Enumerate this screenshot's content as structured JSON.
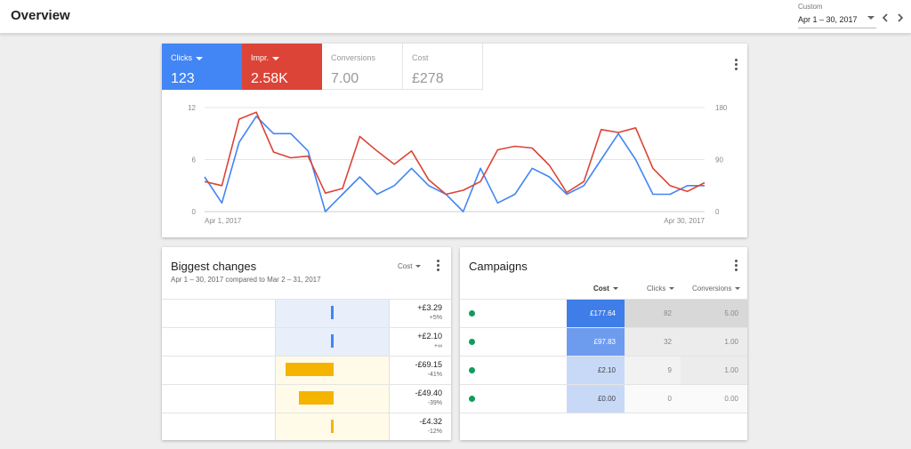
{
  "header": {
    "title": "Overview",
    "date_caption": "Custom",
    "date_range": "Apr 1 – 30, 2017"
  },
  "overview": {
    "metrics": [
      {
        "label": "Clicks",
        "value": "123",
        "active": true,
        "color": "#4285f4"
      },
      {
        "label": "Impr.",
        "value": "2.58K",
        "active": true,
        "color": "#db4437"
      },
      {
        "label": "Conversions",
        "value": "7.00",
        "active": false
      },
      {
        "label": "Cost",
        "value": "£278",
        "active": false
      }
    ]
  },
  "chart_data": {
    "type": "line",
    "x": [
      "Apr 1",
      "Apr 2",
      "Apr 3",
      "Apr 4",
      "Apr 5",
      "Apr 6",
      "Apr 7",
      "Apr 8",
      "Apr 9",
      "Apr 10",
      "Apr 11",
      "Apr 12",
      "Apr 13",
      "Apr 14",
      "Apr 15",
      "Apr 16",
      "Apr 17",
      "Apr 18",
      "Apr 19",
      "Apr 20",
      "Apr 21",
      "Apr 22",
      "Apr 23",
      "Apr 24",
      "Apr 25",
      "Apr 26",
      "Apr 27",
      "Apr 28",
      "Apr 29",
      "Apr 30"
    ],
    "x_tick_labels": [
      "Apr 1, 2017",
      "Apr 30, 2017"
    ],
    "left_axis": {
      "ticks": [
        "12",
        "6",
        "0"
      ],
      "range": [
        0,
        12
      ]
    },
    "right_axis": {
      "ticks": [
        "180",
        "90",
        "0"
      ],
      "range": [
        0,
        180
      ]
    },
    "grid": true,
    "series": [
      {
        "axis": "left",
        "color": "#4285f4",
        "values": [
          4,
          1,
          8,
          11,
          9,
          9,
          7,
          0,
          2,
          4,
          2,
          3,
          5,
          3,
          2,
          0,
          5,
          1,
          2,
          5,
          4,
          2,
          3,
          6,
          9,
          6,
          2,
          2,
          3,
          3
        ]
      },
      {
        "axis": "right",
        "color": "#db4437",
        "values": [
          52,
          45,
          160,
          172,
          103,
          93,
          96,
          32,
          40,
          130,
          105,
          82,
          105,
          55,
          30,
          37,
          52,
          107,
          113,
          110,
          80,
          33,
          52,
          142,
          137,
          145,
          75,
          45,
          35,
          50
        ]
      }
    ]
  },
  "biggest_changes": {
    "title": "Biggest changes",
    "subtitle": "Apr 1 – 30, 2017 compared to Mar 2 – 31, 2017",
    "metric_select": "Cost",
    "rows": [
      {
        "value": "+£3.29",
        "pct": "+5%",
        "change": 3.29
      },
      {
        "value": "+£2.10",
        "pct": "+∞",
        "change": 2.1
      },
      {
        "value": "-£69.15",
        "pct": "-41%",
        "change": -69.15
      },
      {
        "value": "-£49.40",
        "pct": "-39%",
        "change": -49.4
      },
      {
        "value": "-£4.32",
        "pct": "-12%",
        "change": -4.32
      }
    ]
  },
  "campaigns": {
    "title": "Campaigns",
    "columns": [
      "Cost",
      "Clicks",
      "Conversions"
    ],
    "rows": [
      {
        "cost": "£177.64",
        "clicks": "82",
        "conversions": "5.00"
      },
      {
        "cost": "£97.83",
        "clicks": "32",
        "conversions": "1.00"
      },
      {
        "cost": "£2.10",
        "clicks": "9",
        "conversions": "1.00"
      },
      {
        "cost": "£0.00",
        "clicks": "0",
        "conversions": "0.00"
      }
    ]
  },
  "colors": {
    "status_green": "#0f9d58",
    "gain_blue": "#4285f4",
    "loss_orange": "#f4b400"
  }
}
